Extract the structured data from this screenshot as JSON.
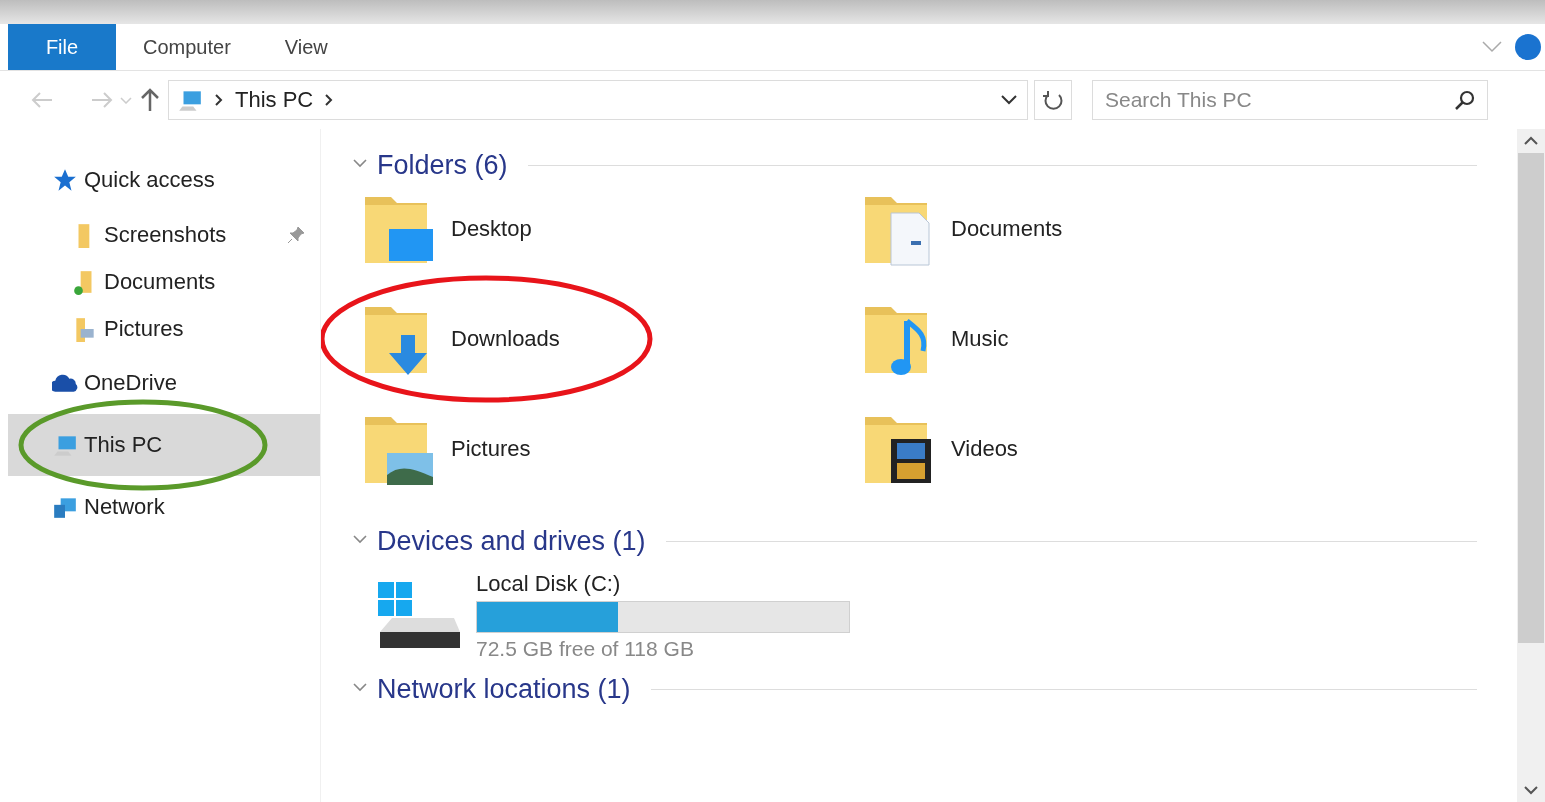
{
  "ribbon": {
    "tabs": [
      {
        "label": "File",
        "selected": true
      },
      {
        "label": "Computer",
        "selected": false
      },
      {
        "label": "View",
        "selected": false
      }
    ]
  },
  "address": {
    "crumbs": [
      "This PC"
    ]
  },
  "search": {
    "placeholder": "Search This PC"
  },
  "nav": [
    {
      "label": "Quick access",
      "kind": "star",
      "selected": false,
      "children": [
        {
          "label": "Screenshots",
          "kind": "folder",
          "selected": false,
          "pinned": true
        },
        {
          "label": "Documents",
          "kind": "synced-folder",
          "selected": false,
          "pinned": false
        },
        {
          "label": "Pictures",
          "kind": "pictures-folder",
          "selected": false,
          "pinned": false
        }
      ]
    },
    {
      "label": "OneDrive",
      "kind": "cloud",
      "selected": false
    },
    {
      "label": "This PC",
      "kind": "pc",
      "selected": true,
      "color": "#5a9a2a"
    },
    {
      "label": "Network",
      "kind": "network",
      "selected": false
    }
  ],
  "sections": [
    {
      "title": "Folders (6)",
      "expanded": true,
      "kind": "folders",
      "items": [
        {
          "label": "Desktop",
          "kind": "desktop"
        },
        {
          "label": "Documents",
          "kind": "documents"
        },
        {
          "label": "Downloads",
          "kind": "downloads",
          "color": "#e8141a"
        },
        {
          "label": "Music",
          "kind": "music"
        },
        {
          "label": "Pictures",
          "kind": "pictures"
        },
        {
          "label": "Videos",
          "kind": "videos"
        }
      ]
    },
    {
      "title": "Devices and drives (1)",
      "expanded": true,
      "kind": "drives",
      "items": [
        {
          "label": "Local Disk (C:)",
          "level": 0.38,
          "free": "72.5 GB free of 118 GB"
        }
      ]
    },
    {
      "title": "Network locations (1)",
      "expanded": true,
      "kind": "network"
    }
  ]
}
